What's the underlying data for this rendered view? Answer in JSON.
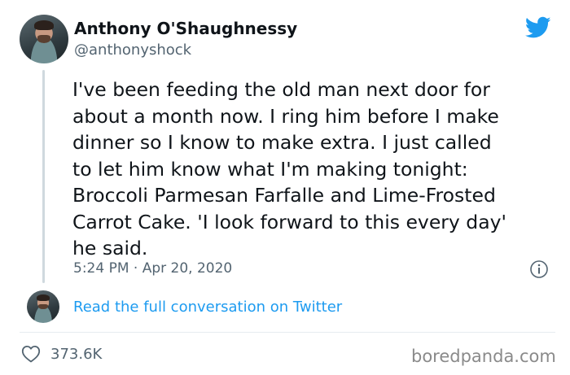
{
  "tweet": {
    "author_name": "Anthony O'Shaughnessy",
    "author_handle": "@anthonyshock",
    "text": "I've been feeding the old man next door for\nabout a month now. I ring him before I make\ndinner so I know to make extra. I just called\nto let him know what I'm making tonight:\nBroccoli Parmesan Farfalle and Lime-Frosted\nCarrot Cake. 'I look forward to this every day'\nhe said.",
    "time": "5:24 PM",
    "separator": "·",
    "date": "Apr 20, 2020",
    "read_more_label": "Read the full conversation on Twitter",
    "likes": "373.6K"
  },
  "icons": {
    "brand": "twitter-bird-icon",
    "info": "info-icon",
    "like": "heart-icon"
  },
  "colors": {
    "twitter_blue": "#1d9bf0",
    "secondary_text": "#536471",
    "primary_text": "#0f1419",
    "divider": "#e6ecf0"
  },
  "watermark": "boredpanda.com"
}
